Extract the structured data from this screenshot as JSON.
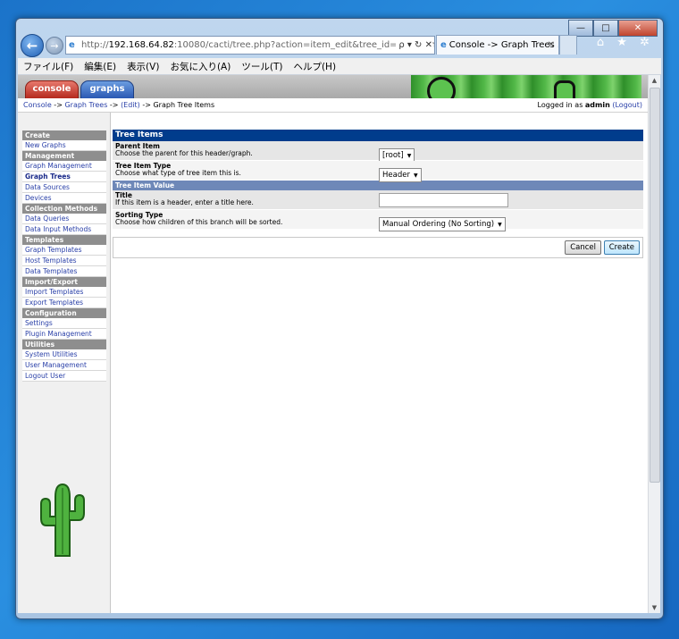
{
  "window": {
    "caption_buttons": [
      "—",
      "□",
      "✕"
    ]
  },
  "browser": {
    "url_prefix": "http://",
    "url_host": "192.168.64.82",
    "url_rest": ":10080/cacti/tree.php?action=item_edit&tree_id=1&parent_id=0",
    "url_tools": "ρ ▾ ↻ ✕",
    "tab_title": "Console -> Graph Trees ...",
    "tab_close": "✕",
    "right_icons": "⌂ ★ ✲",
    "menu": [
      "ファイル(F)",
      "編集(E)",
      "表示(V)",
      "お気に入り(A)",
      "ツール(T)",
      "ヘルプ(H)"
    ]
  },
  "header": {
    "console_tab": "console",
    "graphs_tab": "graphs"
  },
  "breadcrumb": {
    "console": "Console",
    "sep1": " -> ",
    "graph_trees": "Graph Trees",
    "sep2": " -> ",
    "edit": "(Edit)",
    "sep3": " -> Graph Tree Items"
  },
  "login": {
    "prefix": "Logged in as ",
    "user": "admin",
    "logout": "(Logout)"
  },
  "sidebar": {
    "sections": [
      {
        "title": "Create",
        "items": [
          {
            "label": "New Graphs",
            "selected": false
          }
        ]
      },
      {
        "title": "Management",
        "items": [
          {
            "label": "Graph Management",
            "selected": false
          },
          {
            "label": "Graph Trees",
            "selected": true
          },
          {
            "label": "Data Sources",
            "selected": false
          },
          {
            "label": "Devices",
            "selected": false
          }
        ]
      },
      {
        "title": "Collection Methods",
        "items": [
          {
            "label": "Data Queries",
            "selected": false
          },
          {
            "label": "Data Input Methods",
            "selected": false
          }
        ]
      },
      {
        "title": "Templates",
        "items": [
          {
            "label": "Graph Templates",
            "selected": false
          },
          {
            "label": "Host Templates",
            "selected": false
          },
          {
            "label": "Data Templates",
            "selected": false
          }
        ]
      },
      {
        "title": "Import/Export",
        "items": [
          {
            "label": "Import Templates",
            "selected": false
          },
          {
            "label": "Export Templates",
            "selected": false
          }
        ]
      },
      {
        "title": "Configuration",
        "items": [
          {
            "label": "Settings",
            "selected": false
          },
          {
            "label": "Plugin Management",
            "selected": false
          }
        ]
      },
      {
        "title": "Utilities",
        "items": [
          {
            "label": "System Utilities",
            "selected": false
          },
          {
            "label": "User Management",
            "selected": false
          },
          {
            "label": "Logout User",
            "selected": false
          }
        ]
      }
    ]
  },
  "form": {
    "title": "Tree Items",
    "parent_item": {
      "label": "Parent Item",
      "desc": "Choose the parent for this header/graph.",
      "value": "[root]"
    },
    "item_type": {
      "label": "Tree Item Type",
      "desc": "Choose what type of tree item this is.",
      "value": "Header"
    },
    "value_section": "Tree Item Value",
    "title_field": {
      "label": "Title",
      "desc": "If this item is a header, enter a title here.",
      "value": ""
    },
    "sorting": {
      "label": "Sorting Type",
      "desc": "Choose how children of this branch will be sorted.",
      "value": "Manual Ordering (No Sorting)"
    },
    "cancel_label": "Cancel",
    "create_label": "Create"
  },
  "colors": {
    "form_title_bg": "#003c8c",
    "subhead_bg": "#6e88b8",
    "link": "#2a40a8",
    "console_tab": "#c0392b",
    "graphs_tab": "#2a58b3"
  }
}
